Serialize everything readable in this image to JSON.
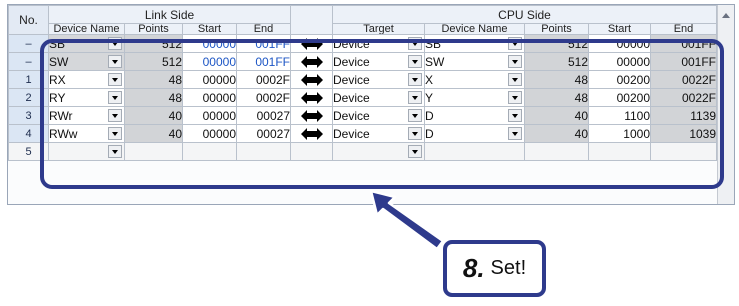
{
  "grid": {
    "header": {
      "no": "No.",
      "link_side": "Link Side",
      "cpu_side": "CPU Side",
      "link_cols": [
        "Device Name",
        "Points",
        "Start",
        "End"
      ],
      "cpu_cols": [
        "Target",
        "Device Name",
        "Points",
        "Start",
        "End"
      ]
    },
    "rows": [
      {
        "no": "–",
        "link_device": "SB",
        "link_points": "512",
        "link_start": "00000",
        "link_end": "001FF",
        "target": "Device",
        "cpu_device": "SB",
        "cpu_points": "512",
        "cpu_start": "00000",
        "cpu_end": "001FF"
      },
      {
        "no": "–",
        "link_device": "SW",
        "link_points": "512",
        "link_start": "00000",
        "link_end": "001FF",
        "target": "Device",
        "cpu_device": "SW",
        "cpu_points": "512",
        "cpu_start": "00000",
        "cpu_end": "001FF"
      },
      {
        "no": "1",
        "link_device": "RX",
        "link_points": "48",
        "link_start": "00000",
        "link_end": "0002F",
        "target": "Device",
        "cpu_device": "X",
        "cpu_points": "48",
        "cpu_start": "00200",
        "cpu_end": "0022F"
      },
      {
        "no": "2",
        "link_device": "RY",
        "link_points": "48",
        "link_start": "00000",
        "link_end": "0002F",
        "target": "Device",
        "cpu_device": "Y",
        "cpu_points": "48",
        "cpu_start": "00200",
        "cpu_end": "0022F"
      },
      {
        "no": "3",
        "link_device": "RWr",
        "link_points": "40",
        "link_start": "00000",
        "link_end": "00027",
        "target": "Device",
        "cpu_device": "D",
        "cpu_points": "40",
        "cpu_start": "1100",
        "cpu_end": "1139"
      },
      {
        "no": "4",
        "link_device": "RWw",
        "link_points": "40",
        "link_start": "00000",
        "link_end": "00027",
        "target": "Device",
        "cpu_device": "D",
        "cpu_points": "40",
        "cpu_start": "1000",
        "cpu_end": "1039"
      }
    ],
    "next_row_no": "5"
  },
  "callout": {
    "step": "8.",
    "text": "Set!"
  },
  "colors": {
    "annotation": "#2e3a8c",
    "blue_value": "#1d56c5"
  }
}
